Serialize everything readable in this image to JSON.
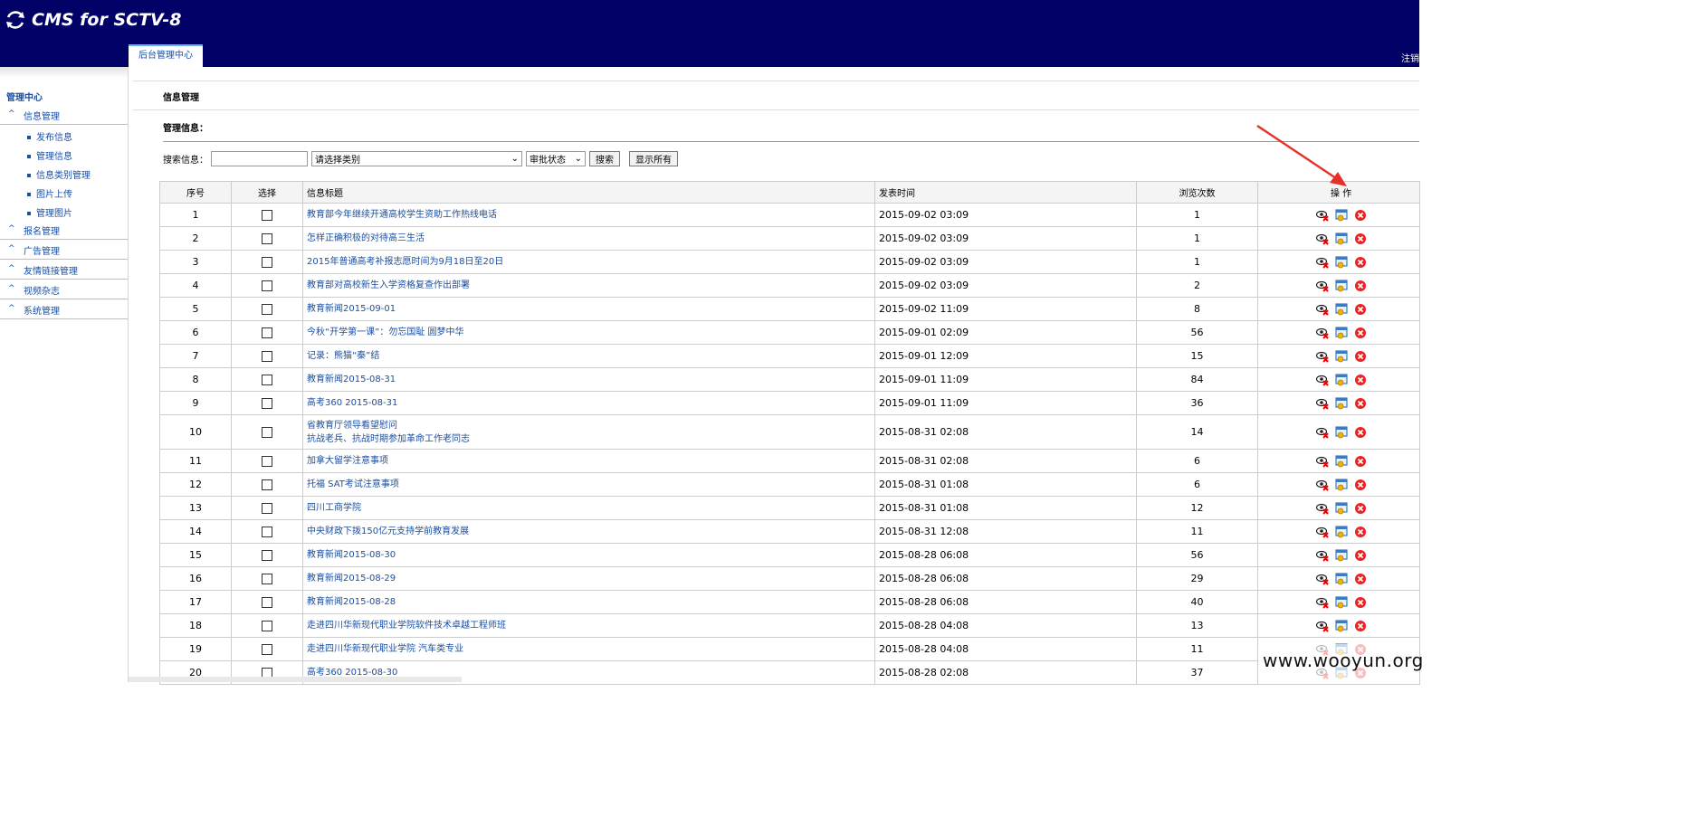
{
  "header": {
    "app_title": "CMS for SCTV-8",
    "tab_label": "后台管理中心",
    "logout_label": "注销"
  },
  "sidebar": {
    "title": "管理中心",
    "groups": [
      {
        "label": "信息管理"
      },
      {
        "label": "报名管理"
      },
      {
        "label": "广告管理"
      },
      {
        "label": "友情链接管理"
      },
      {
        "label": "视频杂志"
      },
      {
        "label": "系统管理"
      }
    ],
    "sub_items": [
      "发布信息",
      "管理信息",
      "信息类别管理",
      "图片上传",
      "管理图片"
    ]
  },
  "main": {
    "breadcrumb": "信息管理",
    "section_title": "管理信息：",
    "search": {
      "label": "搜索信息：",
      "input_value": "",
      "category_select": "请选择类别",
      "status_select": "审批状态",
      "search_button": "搜索",
      "show_all_button": "显示所有"
    },
    "table": {
      "headers": [
        "序号",
        "选择",
        "信息标题",
        "发表时间",
        "浏览次数",
        "操 作"
      ],
      "rows": [
        {
          "num": "1",
          "title": "教育部今年继续开通高校学生资助工作热线电话",
          "date": "2015-09-02 03:09",
          "views": "1"
        },
        {
          "num": "2",
          "title": "怎样正确积极的对待高三生活",
          "date": "2015-09-02 03:09",
          "views": "1"
        },
        {
          "num": "3",
          "title": "2015年普通高考补报志愿时间为9月18日至20日",
          "date": "2015-09-02 03:09",
          "views": "1"
        },
        {
          "num": "4",
          "title": "教育部对高校新生入学资格复查作出部署",
          "date": "2015-09-02 03:09",
          "views": "2"
        },
        {
          "num": "5",
          "title": "教育新闻2015-09-01",
          "date": "2015-09-02 11:09",
          "views": "8"
        },
        {
          "num": "6",
          "title": "今秋“开学第一课”：勿忘国耻 圆梦中华",
          "date": "2015-09-01 02:09",
          "views": "56"
        },
        {
          "num": "7",
          "title": "记录：熊猫“秦”结",
          "date": "2015-09-01 12:09",
          "views": "15"
        },
        {
          "num": "8",
          "title": "教育新闻2015-08-31",
          "date": "2015-09-01 11:09",
          "views": "84"
        },
        {
          "num": "9",
          "title": "高考360 2015-08-31",
          "date": "2015-09-01 11:09",
          "views": "36"
        },
        {
          "num": "10",
          "title": "省教育厅领导看望慰问\n抗战老兵、抗战时期参加革命工作老同志",
          "date": "2015-08-31 02:08",
          "views": "14"
        },
        {
          "num": "11",
          "title": "加拿大留学注意事项",
          "date": "2015-08-31 02:08",
          "views": "6"
        },
        {
          "num": "12",
          "title": "托福 SAT考试注意事项",
          "date": "2015-08-31 01:08",
          "views": "6"
        },
        {
          "num": "13",
          "title": "四川工商学院",
          "date": "2015-08-31 01:08",
          "views": "12"
        },
        {
          "num": "14",
          "title": "中央财政下拨150亿元支持学前教育发展",
          "date": "2015-08-31 12:08",
          "views": "11"
        },
        {
          "num": "15",
          "title": "教育新闻2015-08-30",
          "date": "2015-08-28 06:08",
          "views": "56"
        },
        {
          "num": "16",
          "title": "教育新闻2015-08-29",
          "date": "2015-08-28 06:08",
          "views": "29"
        },
        {
          "num": "17",
          "title": "教育新闻2015-08-28",
          "date": "2015-08-28 06:08",
          "views": "40"
        },
        {
          "num": "18",
          "title": "走进四川华新现代职业学院软件技术卓越工程师班",
          "date": "2015-08-28 04:08",
          "views": "13"
        },
        {
          "num": "19",
          "title": "走进四川华新现代职业学院 汽车类专业",
          "date": "2015-08-28 04:08",
          "views": "11"
        },
        {
          "num": "20",
          "title": "高考360 2015-08-30",
          "date": "2015-08-28 02:08",
          "views": "37"
        }
      ]
    }
  },
  "watermark": "www.wooyun.org",
  "colors": {
    "header_bg": "#000066",
    "link": "#1a4fa3",
    "annotation_arrow": "#e8302a"
  }
}
